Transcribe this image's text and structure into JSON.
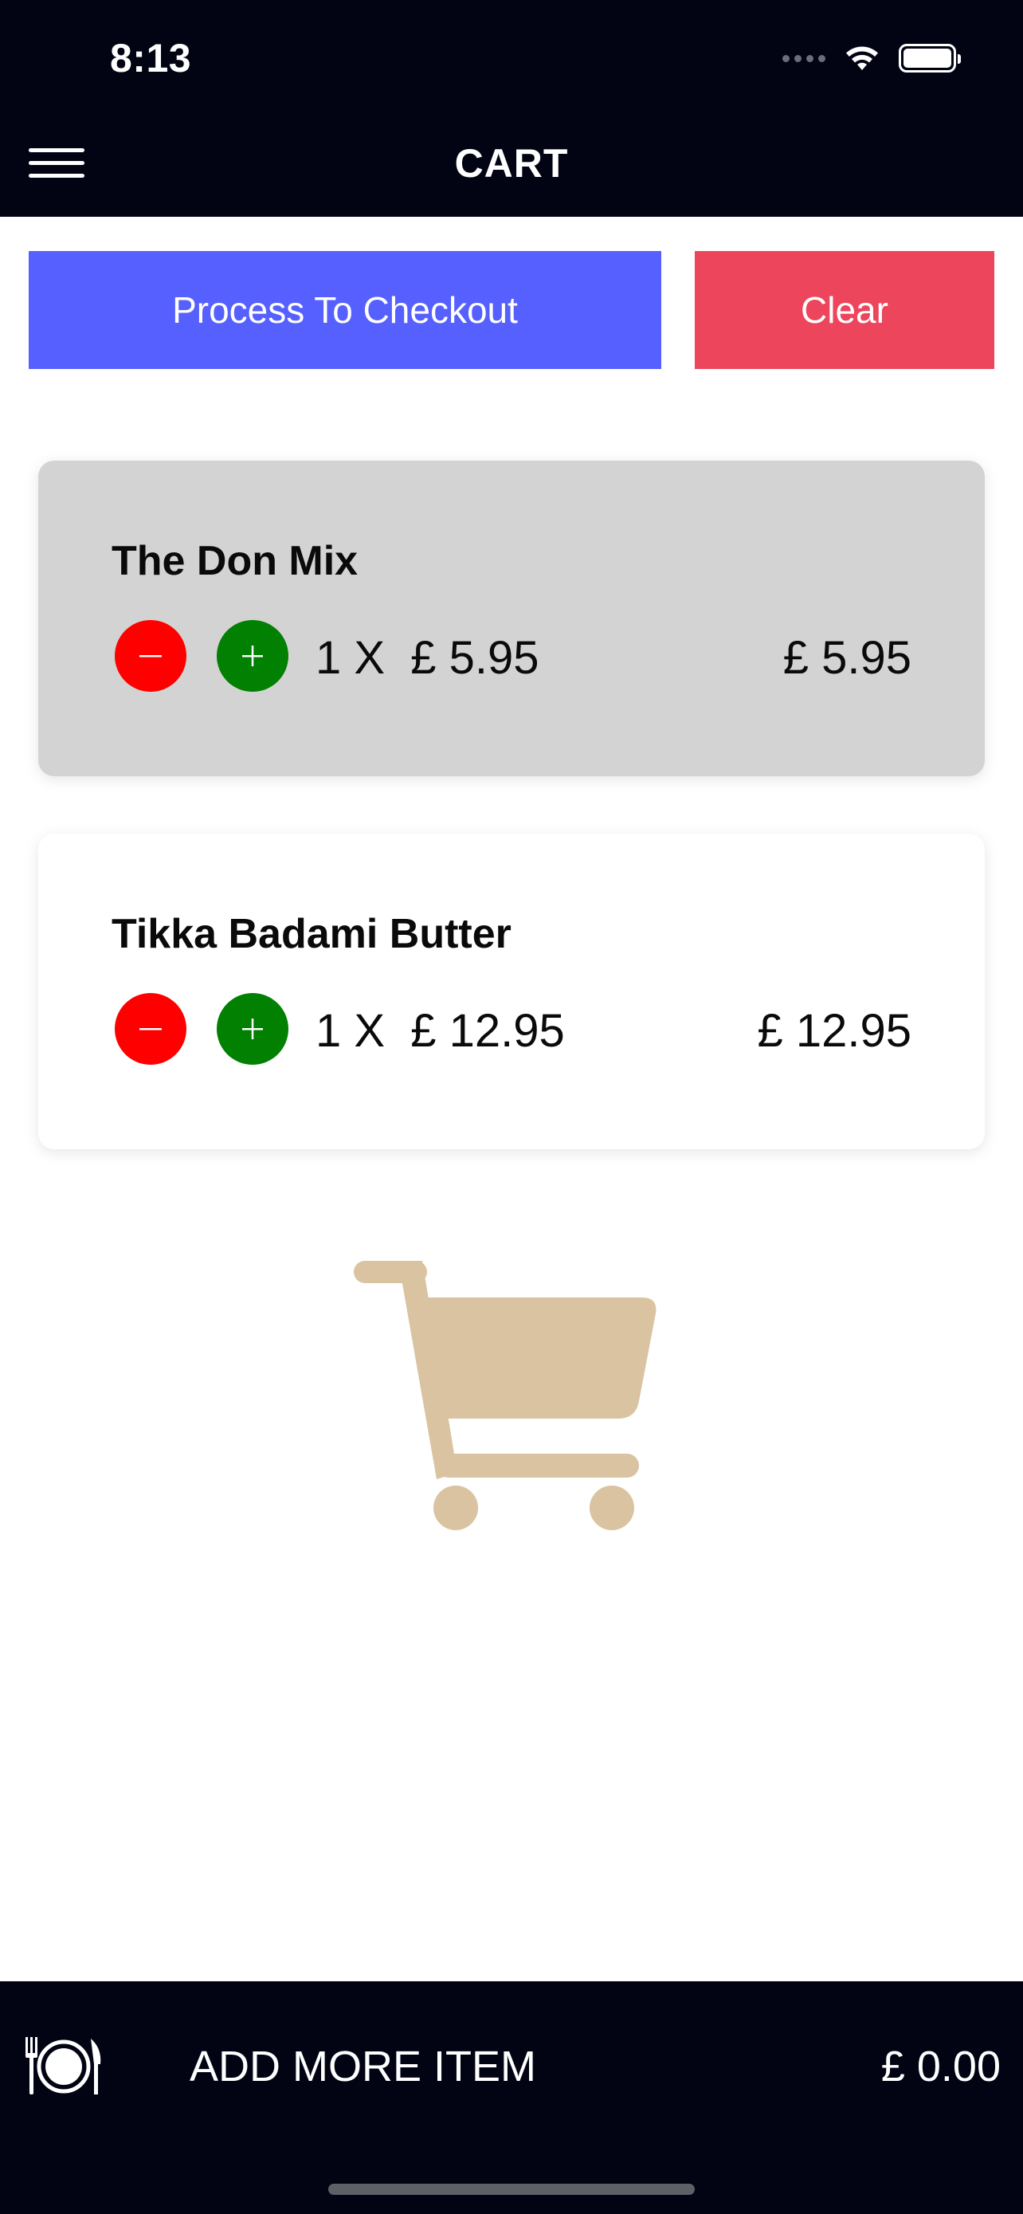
{
  "status_bar": {
    "time": "8:13",
    "icons": [
      "signal-icon",
      "wifi-icon",
      "battery-icon"
    ]
  },
  "header": {
    "title": "CART",
    "menu_icon": "hamburger-menu-icon"
  },
  "actions": {
    "checkout_label": "Process To Checkout",
    "clear_label": "Clear"
  },
  "cart": {
    "items": [
      {
        "name": "The Don Mix",
        "quantity_text": "1 X  £ 5.95",
        "line_total": "£ 5.95"
      },
      {
        "name": "Tikka Badami Butter",
        "quantity_text": "1 X  £ 12.95",
        "line_total": "£ 12.95"
      }
    ],
    "illustration_icon": "shopping-cart-icon"
  },
  "bottom_bar": {
    "icon": "restaurant-plate-icon",
    "add_more_label": "ADD MORE ITEM",
    "total": "£ 0.00"
  },
  "colors": {
    "bar_background": "#020414",
    "checkout": "#5560fe",
    "clear": "#ec455c",
    "minus": "#fe0000",
    "plus": "#018001",
    "selected_card": "#d3d3d3",
    "cart_illustration": "#dac3a0"
  }
}
